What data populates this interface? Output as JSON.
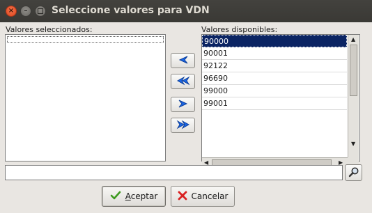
{
  "window": {
    "title": "Seleccione valores para VDN"
  },
  "selected_panel": {
    "label": "Valores seleccionados:"
  },
  "available_panel": {
    "label": "Valores disponibles:",
    "items": [
      "90000",
      "90001",
      "92122",
      "96690",
      "99000",
      "99001"
    ]
  },
  "transfer_buttons": {
    "move_left": "left-arrow-icon",
    "move_all_left": "double-left-arrow-icon",
    "move_right": "right-arrow-icon",
    "move_all_right": "double-right-arrow-icon"
  },
  "search": {
    "value": ""
  },
  "buttons": {
    "accept": {
      "mnemonic": "A",
      "rest": "ceptar"
    },
    "cancel": {
      "label": "Cancelar"
    }
  },
  "colors": {
    "selection": "#0b2463",
    "arrow": "#1a66e6"
  }
}
